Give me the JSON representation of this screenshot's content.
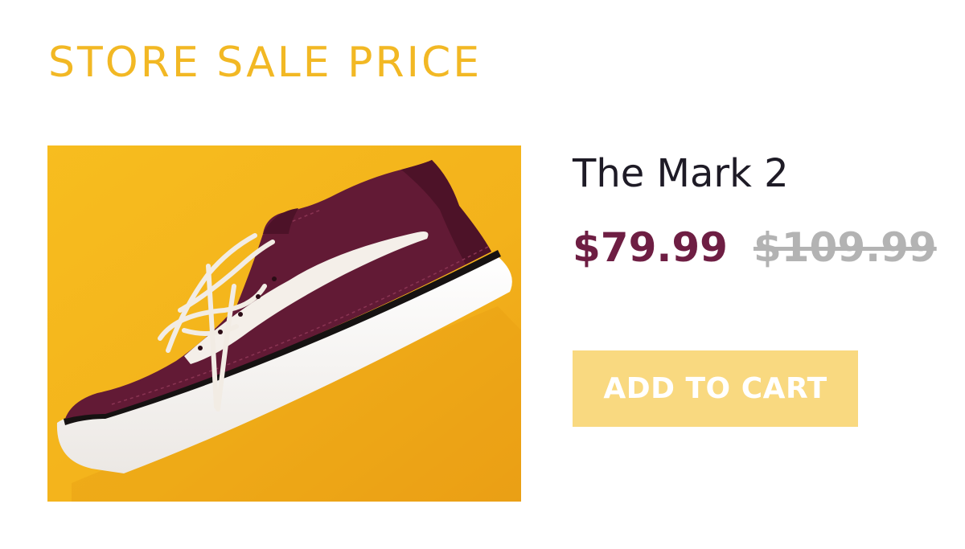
{
  "header": {
    "title": "STORE SALE PRICE"
  },
  "product": {
    "name": "The Mark 2",
    "sale_price": "$79.99",
    "original_price": "$109.99",
    "image_icon": "sneaker-photo"
  },
  "actions": {
    "add_to_cart_label": "ADD TO CART"
  },
  "colors": {
    "title_accent": "#f2b824",
    "sale_price": "#6e1e43",
    "original_price": "#b3b3b3",
    "button_background": "#f9d980",
    "button_text": "#ffffff",
    "image_background": "#f4b41c",
    "shoe_canvas": "#641a35"
  }
}
